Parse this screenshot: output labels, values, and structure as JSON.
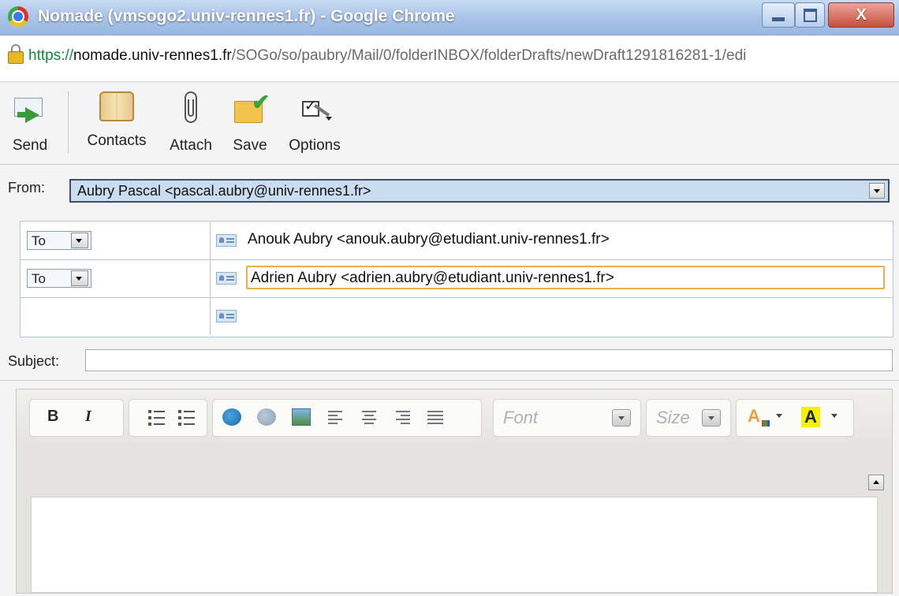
{
  "window": {
    "title": "Nomade (vmsogo2.univ-rennes1.fr) - Google Chrome",
    "close_glyph": "X"
  },
  "address": {
    "scheme": "https://",
    "host": "nomade.univ-rennes1.fr",
    "path": "/SOGo/so/paubry/Mail/0/folderINBOX/folderDrafts/newDraft1291816281-1/edi"
  },
  "toolbar": {
    "send_label": "Send",
    "contacts_label": "Contacts",
    "attach_label": "Attach",
    "save_label": "Save",
    "options_label": "Options"
  },
  "from": {
    "label": "From:",
    "value": "Aubry Pascal <pascal.aubry@univ-rennes1.fr>"
  },
  "recipients": [
    {
      "type": "To",
      "address": "Anouk Aubry <anouk.aubry@etudiant.univ-rennes1.fr>"
    },
    {
      "type": "To",
      "address": "Adrien Aubry <adrien.aubry@etudiant.univ-rennes1.fr>"
    },
    {
      "type": "",
      "address": ""
    }
  ],
  "subject": {
    "label": "Subject:",
    "value": ""
  },
  "editor": {
    "bold": "B",
    "italic": "I",
    "font_placeholder": "Font",
    "size_placeholder": "Size",
    "text_color_glyph": "A",
    "bg_color_glyph": "A",
    "body": ""
  },
  "colors": {
    "titlebar": "#a9c3e8",
    "https_green": "#118a3a",
    "focus_border": "#e8b04a",
    "from_select_bg": "#c9dcf0"
  }
}
